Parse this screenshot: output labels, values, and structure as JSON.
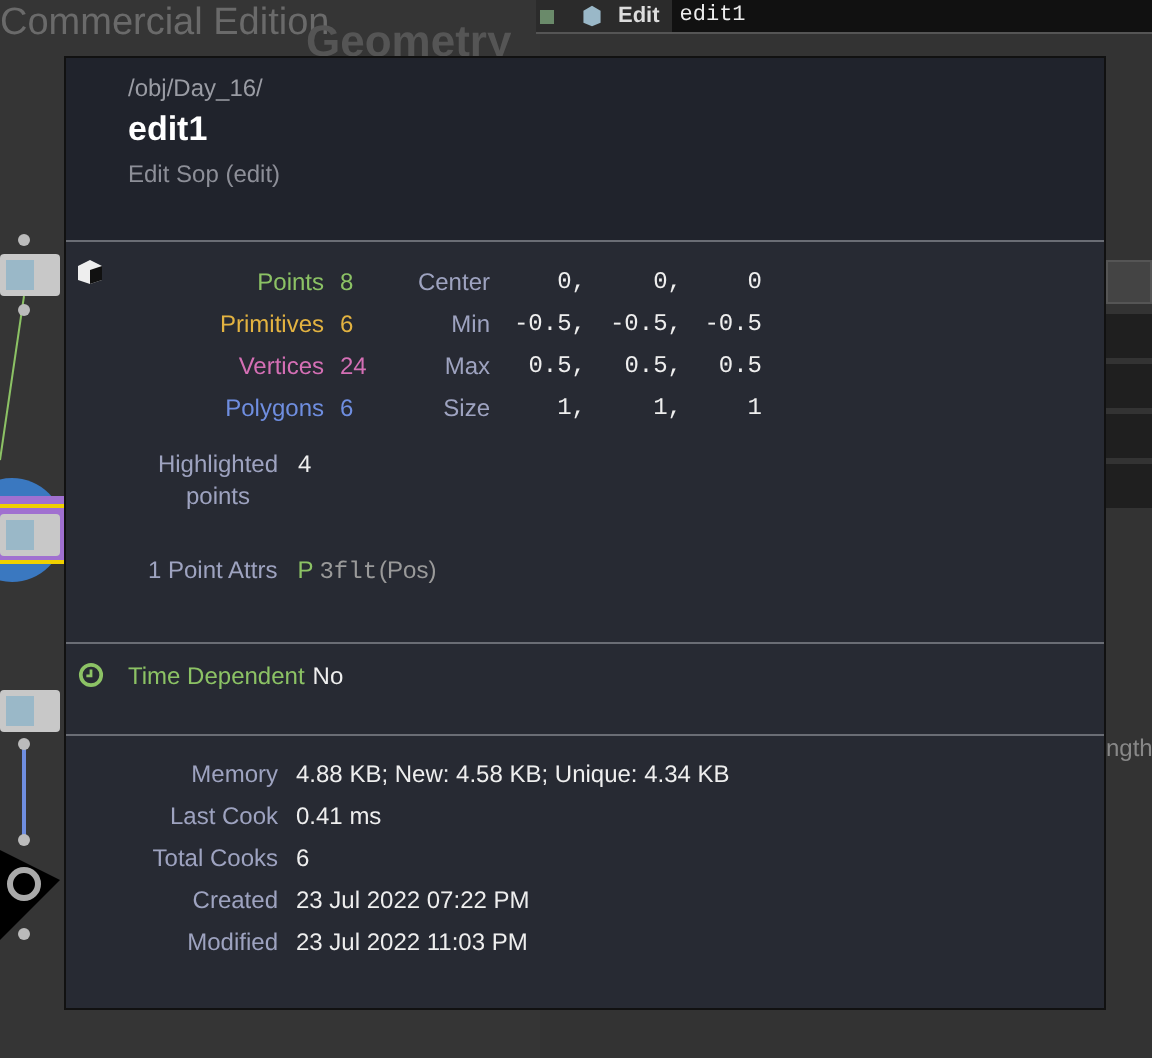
{
  "background": {
    "watermark": "Commercial Edition",
    "network_label": "Geometry",
    "parm_header": {
      "type_label": "Edit",
      "name_value": "edit1"
    },
    "cut_label": "ngth"
  },
  "popup": {
    "path": "/obj/Day_16/",
    "name": "edit1",
    "type": "Edit Sop (edit)",
    "counts": [
      {
        "label": "Points",
        "value": "8",
        "color": "#8cc265"
      },
      {
        "label": "Primitives",
        "value": "6",
        "color": "#e3b341"
      },
      {
        "label": "Vertices",
        "value": "24",
        "color": "#d46fb5"
      },
      {
        "label": "Polygons",
        "value": "6",
        "color": "#6f8ee0"
      }
    ],
    "bounds": [
      {
        "label": "Center",
        "values": [
          "0,",
          "0,",
          "0"
        ]
      },
      {
        "label": "Min",
        "values": [
          "-0.5,",
          "-0.5,",
          "-0.5"
        ]
      },
      {
        "label": "Max",
        "values": [
          "0.5,",
          "0.5,",
          "0.5"
        ]
      },
      {
        "label": "Size",
        "values": [
          "1,",
          "1,",
          "1"
        ]
      }
    ],
    "highlighted": {
      "label": "Highlighted points",
      "value": "4"
    },
    "attrs": {
      "label": "1 Point Attrs",
      "name": "P",
      "type": "3flt",
      "desc": "(Pos)"
    },
    "time_dependent": {
      "label": "Time Dependent",
      "value": "No"
    },
    "info": [
      {
        "label": "Memory",
        "value": "4.88 KB; New: 4.58 KB; Unique: 4.34 KB"
      },
      {
        "label": "Last Cook",
        "value": "0.41 ms"
      },
      {
        "label": "Total Cooks",
        "value": "6"
      },
      {
        "label": "Created",
        "value": "23 Jul 2022 07:22 PM"
      },
      {
        "label": "Modified",
        "value": "23 Jul 2022 11:03 PM"
      }
    ]
  }
}
